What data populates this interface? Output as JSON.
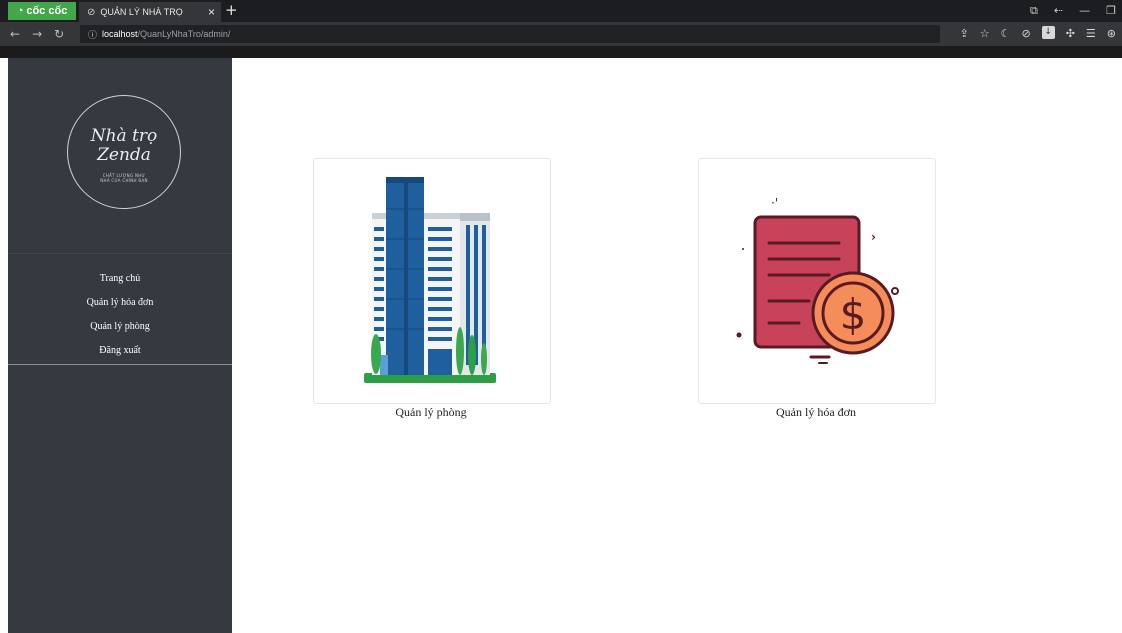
{
  "browser": {
    "brand": "cốc cốc",
    "tab_title": "QUẢN LÝ NHÀ TRỌ",
    "url_host": "localhost",
    "url_path": "/QuanLyNhaTro/admin/"
  },
  "logo": {
    "line1": "Nhà trọ",
    "line2": "Zenda",
    "tagline1": "CHẤT LƯỢNG NHƯ",
    "tagline2": "NHÀ CỦA CHÍNH BẠN"
  },
  "menu": {
    "items": [
      {
        "label": "Trang chủ"
      },
      {
        "label": "Quản lý hóa đơn"
      },
      {
        "label": "Quản lý phòng"
      },
      {
        "label": "Đăng xuất"
      }
    ]
  },
  "cards": [
    {
      "caption": "Quản lý phòng",
      "icon": "building-icon"
    },
    {
      "caption": "Quản lý hóa đơn",
      "icon": "invoice-dollar-icon"
    }
  ],
  "colors": {
    "sidebar": "#343a40",
    "building_blue": "#1f5f9e",
    "invoice_red": "#c8435a",
    "coin_orange": "#f58d5a"
  }
}
